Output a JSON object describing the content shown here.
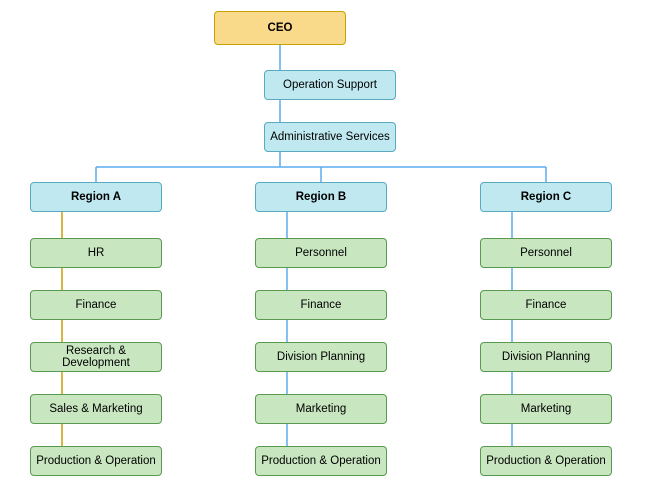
{
  "nodes": {
    "ceo": "CEO",
    "op_support": "Operation Support",
    "admin_services": "Administrative Services",
    "region_a": "Region A",
    "region_b": "Region B",
    "region_c": "Region C",
    "a_hr": "HR",
    "a_finance": "Finance",
    "a_rd": "Research & Development",
    "a_sm": "Sales & Marketing",
    "a_po": "Production & Operation",
    "b_personnel": "Personnel",
    "b_finance": "Finance",
    "b_dp": "Division Planning",
    "b_marketing": "Marketing",
    "b_po": "Production & Operation",
    "c_personnel": "Personnel",
    "c_finance": "Finance",
    "c_dp": "Division Planning",
    "c_marketing": "Marketing",
    "c_po": "Production & Operation"
  },
  "colors": {
    "ceo_bg": "#f9d98a",
    "ceo_border": "#c8a000",
    "support_bg": "#c0e8f0",
    "support_border": "#5aaabf",
    "dept_bg": "#c8e6c0",
    "dept_border": "#5a9a50",
    "line": "#5aaabf"
  }
}
